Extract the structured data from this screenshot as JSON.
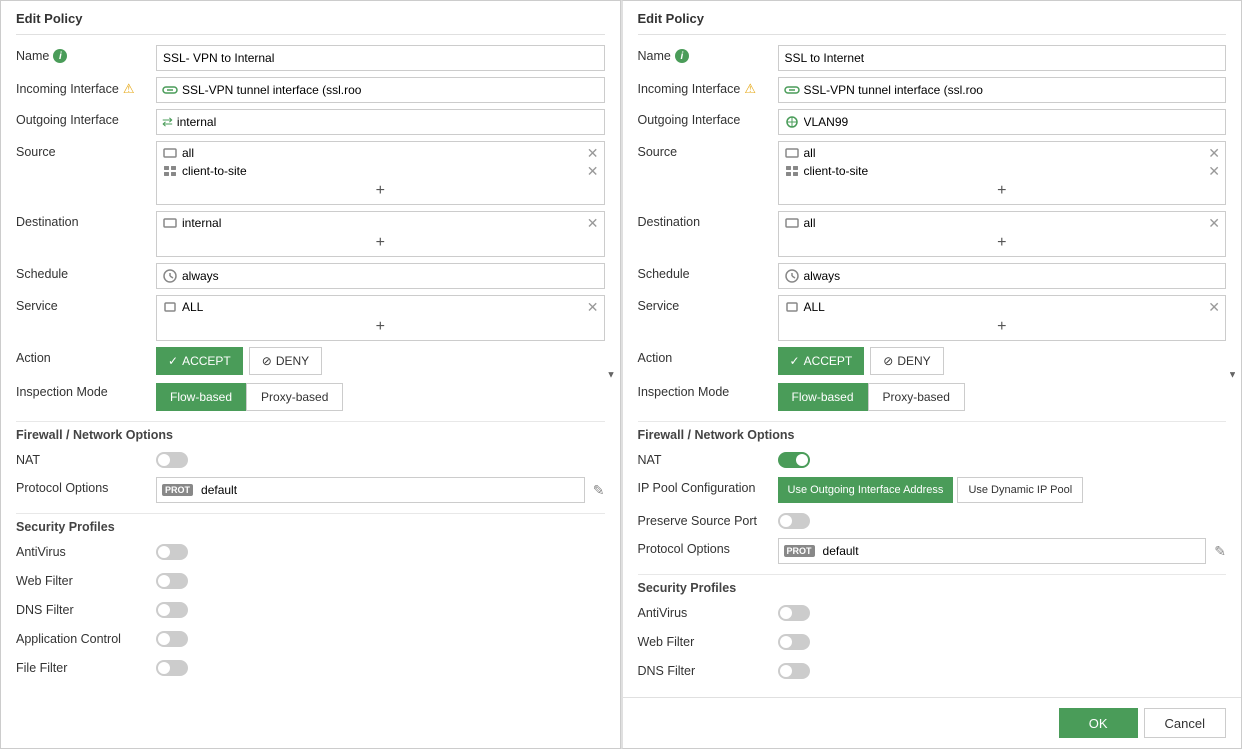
{
  "left_panel": {
    "title": "Edit Policy",
    "name_label": "Name",
    "name_value": "SSL- VPN to Internal",
    "incoming_interface_label": "Incoming Interface",
    "incoming_interface_value": "SSL-VPN tunnel interface (ssl.roo",
    "outgoing_interface_label": "Outgoing Interface",
    "outgoing_interface_value": "internal",
    "source_label": "Source",
    "source_items": [
      "all",
      "client-to-site"
    ],
    "destination_label": "Destination",
    "destination_items": [
      "internal"
    ],
    "schedule_label": "Schedule",
    "schedule_value": "always",
    "service_label": "Service",
    "service_items": [
      "ALL"
    ],
    "action_label": "Action",
    "accept_label": "ACCEPT",
    "deny_label": "DENY",
    "inspection_mode_label": "Inspection Mode",
    "flow_based_label": "Flow-based",
    "proxy_based_label": "Proxy-based",
    "firewall_network_options": "Firewall / Network Options",
    "nat_label": "NAT",
    "nat_enabled": false,
    "protocol_options_label": "Protocol Options",
    "protocol_options_value": "default",
    "security_profiles_label": "Security Profiles",
    "antivirus_label": "AntiVirus",
    "antivirus_enabled": false,
    "web_filter_label": "Web Filter",
    "web_filter_enabled": false,
    "dns_filter_label": "DNS Filter",
    "dns_filter_enabled": false,
    "application_control_label": "Application Control",
    "application_control_enabled": false,
    "file_filter_label": "File Filter",
    "file_filter_enabled": false
  },
  "right_panel": {
    "title": "Edit Policy",
    "name_label": "Name",
    "name_value": "SSL to Internet",
    "incoming_interface_label": "Incoming Interface",
    "incoming_interface_value": "SSL-VPN tunnel interface (ssl.roo",
    "outgoing_interface_label": "Outgoing Interface",
    "outgoing_interface_value": "VLAN99",
    "source_label": "Source",
    "source_items": [
      "all",
      "client-to-site"
    ],
    "destination_label": "Destination",
    "destination_items": [
      "all"
    ],
    "schedule_label": "Schedule",
    "schedule_value": "always",
    "service_label": "Service",
    "service_items": [
      "ALL"
    ],
    "action_label": "Action",
    "accept_label": "ACCEPT",
    "deny_label": "DENY",
    "inspection_mode_label": "Inspection Mode",
    "flow_based_label": "Flow-based",
    "proxy_based_label": "Proxy-based",
    "firewall_network_options": "Firewall / Network Options",
    "nat_label": "NAT",
    "nat_enabled": true,
    "ip_pool_config_label": "IP Pool Configuration",
    "use_outgoing_label": "Use Outgoing Interface Address",
    "use_dynamic_label": "Use Dynamic IP Pool",
    "preserve_source_port_label": "Preserve Source Port",
    "preserve_source_port_enabled": false,
    "protocol_options_label": "Protocol Options",
    "protocol_options_value": "default",
    "security_profiles_label": "Security Profiles",
    "antivirus_label": "AntiVirus",
    "antivirus_enabled": false,
    "web_filter_label": "Web Filter",
    "web_filter_enabled": false,
    "dns_filter_label": "DNS Filter",
    "dns_filter_enabled": false,
    "ok_label": "OK",
    "cancel_label": "Cancel"
  },
  "icons": {
    "info": "i",
    "warning": "⚠",
    "check": "✓",
    "deny_circle": "⊘",
    "add": "+",
    "remove": "✕",
    "prot": "PROT",
    "edit": "✎",
    "chevron": "▾"
  }
}
